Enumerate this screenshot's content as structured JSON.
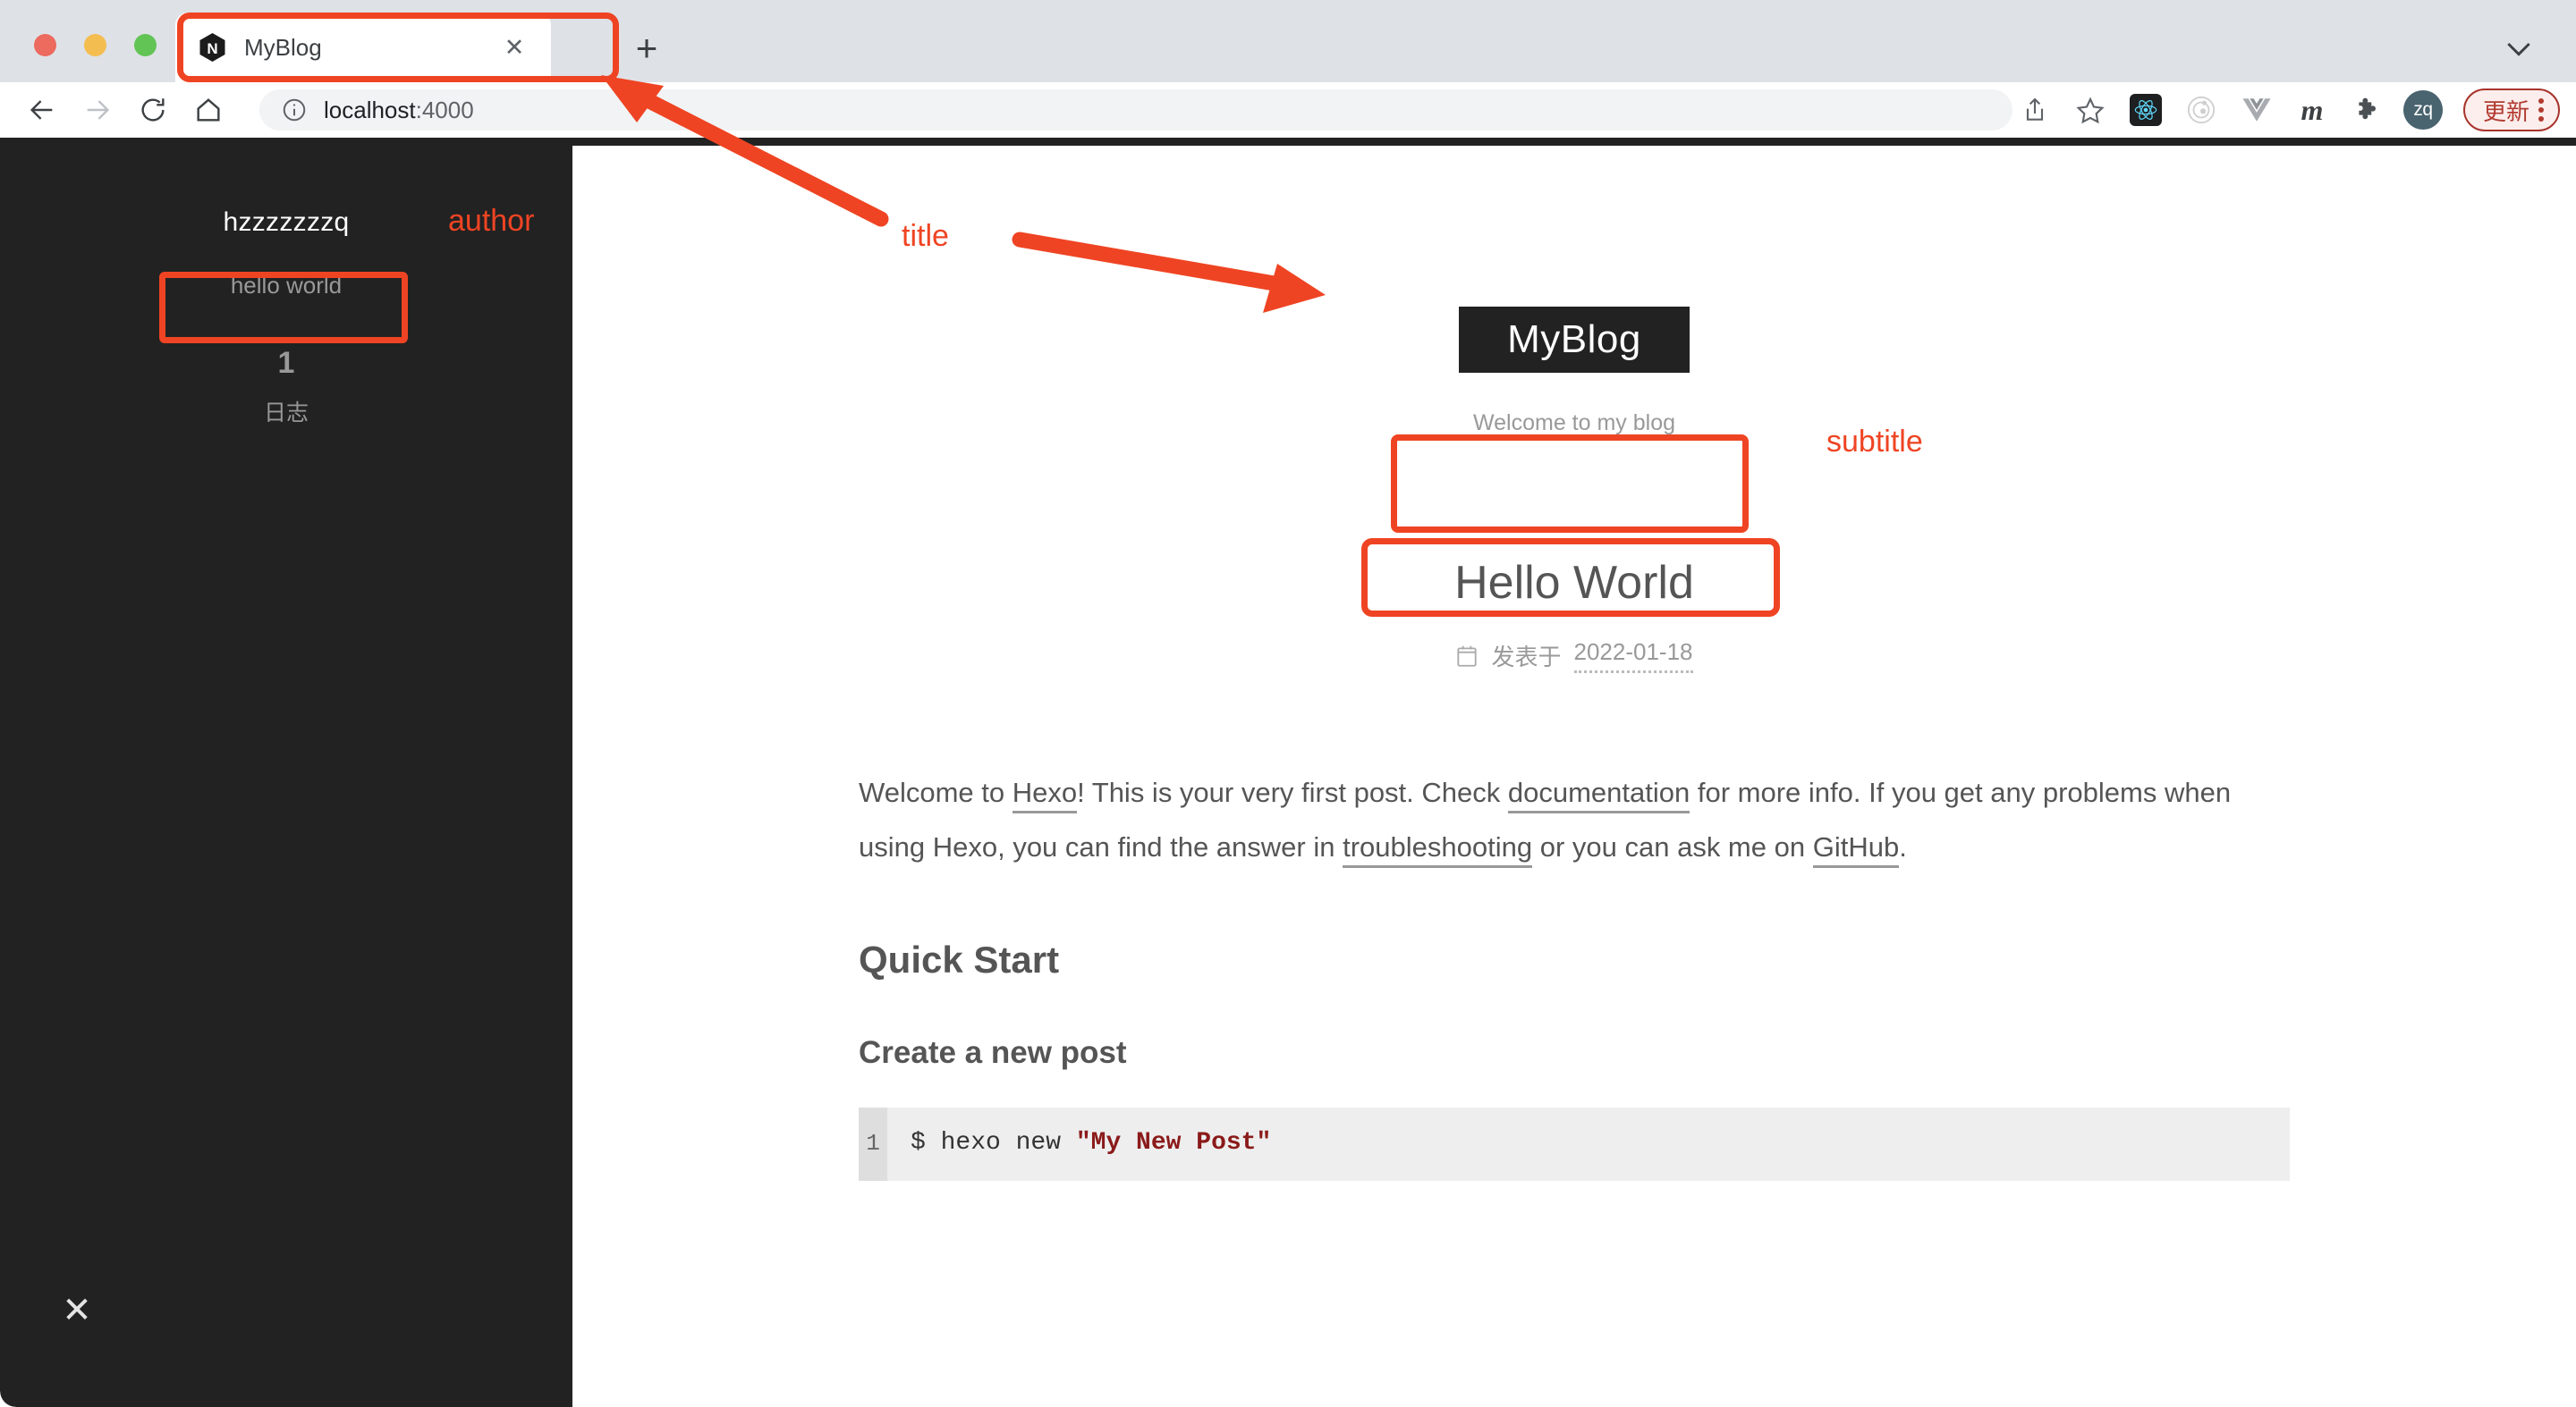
{
  "browser": {
    "tab": {
      "title": "MyBlog",
      "favicon": "hexo-n-icon",
      "close_label": "✕"
    },
    "new_tab_label": "+",
    "toolbar": {
      "back": "back-arrow-icon",
      "forward": "forward-arrow-icon",
      "reload": "reload-icon",
      "home": "home-icon",
      "url_secure_prefix": "localhost",
      "url_suffix": ":4000",
      "url_full": "localhost:4000",
      "share_icon": "share-icon",
      "bookmark_icon": "star-icon",
      "extensions": [
        "react-icon",
        "orbit-icon",
        "vue-icon",
        "medium-m-icon",
        "puzzle-icon"
      ],
      "profile_initials": "zq",
      "update_label": "更新",
      "menu_icon": "kebab-menu-icon"
    }
  },
  "sidebar": {
    "author": "hzzzzzzzq",
    "description": "hello world",
    "post_count": "1",
    "post_count_label": "日志",
    "close_label": "✕"
  },
  "site": {
    "title": "MyBlog",
    "subtitle": "Welcome to my blog"
  },
  "post": {
    "title": "Hello World",
    "meta_prefix": "发表于",
    "date": "2022-01-18",
    "calendar_icon": "calendar-icon",
    "paragraph": {
      "p1": "Welcome to ",
      "link1": "Hexo",
      "p2": "! This is your very first post. Check ",
      "link2": "documentation",
      "p3": " for more info. If you get any problems when using Hexo, you can find the answer in ",
      "link3": "troubleshooting",
      "p4": " or you can ask me on ",
      "link4": "GitHub",
      "p5": "."
    },
    "heading_quick_start": "Quick Start",
    "heading_create_post": "Create a new post",
    "code": {
      "line_number": "1",
      "prefix": "$ hexo new ",
      "string": "\"My New Post\""
    }
  },
  "annotations": {
    "title": "title",
    "author": "author",
    "subtitle": "subtitle",
    "color": "#ef4423"
  },
  "colors": {
    "sidebar_bg": "#222222",
    "accent_red": "#ef4423",
    "chrome_bg": "#dee1e6",
    "code_bg": "#eeeeee",
    "code_gutter": "#dedede",
    "text_gray": "#555555",
    "muted_gray": "#999999"
  }
}
